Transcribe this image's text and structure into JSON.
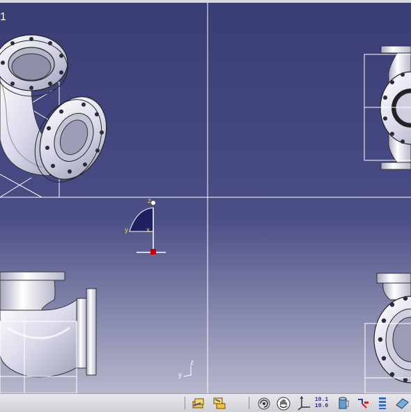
{
  "window": {
    "title_fragment": "1"
  },
  "compass": {
    "z": "z",
    "y": "y",
    "x": "x"
  },
  "axis_small": {
    "z": "z",
    "y": "y"
  },
  "toolbar": {
    "buttons": [
      {
        "icon": "folder-stack-icon"
      },
      {
        "icon": "folder-tree-icon"
      },
      {
        "icon": "rotate-icon"
      },
      {
        "icon": "pan-hand-icon"
      },
      {
        "icon": "axis-system-icon"
      },
      {
        "icon": "measure-icon",
        "label_top": "10.1",
        "label_bottom": "10.0"
      },
      {
        "icon": "cylinder-icon"
      },
      {
        "icon": "constraint-icon"
      },
      {
        "icon": "stack-icon"
      },
      {
        "icon": "render-style-icon"
      }
    ]
  },
  "colors": {
    "background_top": "#3a3d74",
    "background_bottom": "#b7b8cc",
    "part": "#e1e1ee",
    "accent": "#cc0000"
  }
}
